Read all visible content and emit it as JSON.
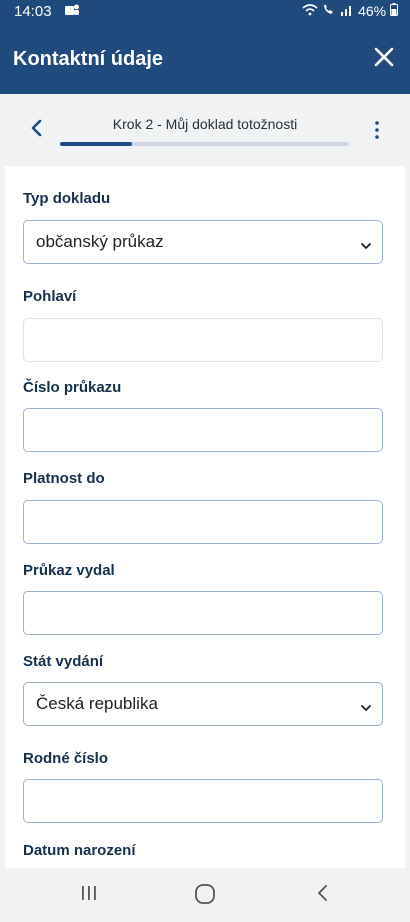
{
  "status_bar": {
    "time": "14:03",
    "battery": "46%"
  },
  "app_bar": {
    "title": "Kontaktní údaje"
  },
  "stepper": {
    "step_label": "Krok 2 - Můj doklad totožnosti",
    "progress_fraction": 0.25
  },
  "form": {
    "document_type": {
      "label": "Typ dokladu",
      "value": "občanský průkaz"
    },
    "gender": {
      "label": "Pohlaví",
      "value": ""
    },
    "card_number": {
      "label": "Číslo průkazu",
      "value": ""
    },
    "valid_until": {
      "label": "Platnost do",
      "value": ""
    },
    "issued_by": {
      "label": "Průkaz vydal",
      "value": ""
    },
    "issuing_country": {
      "label": "Stát vydání",
      "value": "Česká republika"
    },
    "birth_number": {
      "label": "Rodné číslo",
      "value": ""
    },
    "birth_date": {
      "label": "Datum narození"
    }
  },
  "icons": {
    "close": "close-icon",
    "back": "chevron-left-icon",
    "more": "more-vert-icon",
    "dropdown": "chevron-down-icon",
    "nav_recent": "recent-apps-icon",
    "nav_home": "home-icon",
    "nav_back": "nav-back-icon"
  },
  "colors": {
    "primary": "#1e4a7d",
    "progress_track": "#cfd8e3",
    "field_border": "#9db2cb"
  }
}
